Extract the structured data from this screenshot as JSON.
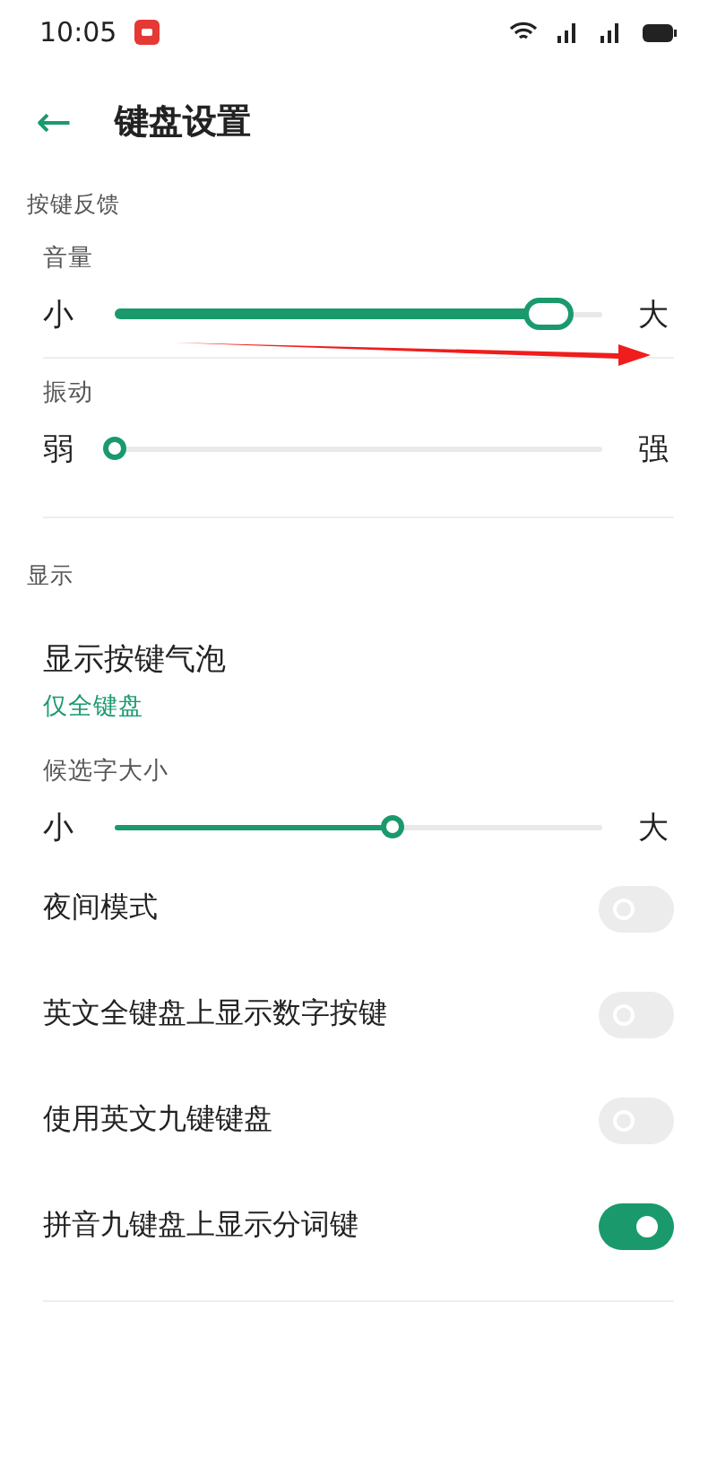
{
  "status_bar": {
    "time": "10:05"
  },
  "header": {
    "back": "←",
    "title": "键盘设置"
  },
  "sections": [
    {
      "title": "按键反馈",
      "items": [
        {
          "kind": "slider",
          "label": "音量",
          "min_label": "小",
          "max_label": "大",
          "level": 0.89
        },
        {
          "kind": "slider",
          "label": "振动",
          "min_label": "弱",
          "max_label": "强",
          "level": 0.0
        }
      ]
    },
    {
      "title": "显示",
      "items": [
        {
          "kind": "option",
          "label": "显示按键气泡",
          "value": "仅全键盘"
        },
        {
          "kind": "slider",
          "label": "候选字大小",
          "min_label": "小",
          "max_label": "大",
          "level": 0.57
        },
        {
          "kind": "toggle",
          "label": "夜间模式",
          "on": false
        },
        {
          "kind": "toggle",
          "label": "英文全键盘上显示数字按键",
          "on": false
        },
        {
          "kind": "toggle",
          "label": "使用英文九键键盘",
          "on": false
        },
        {
          "kind": "toggle",
          "label": "拼音九键盘上显示分词键",
          "on": true
        }
      ]
    }
  ]
}
